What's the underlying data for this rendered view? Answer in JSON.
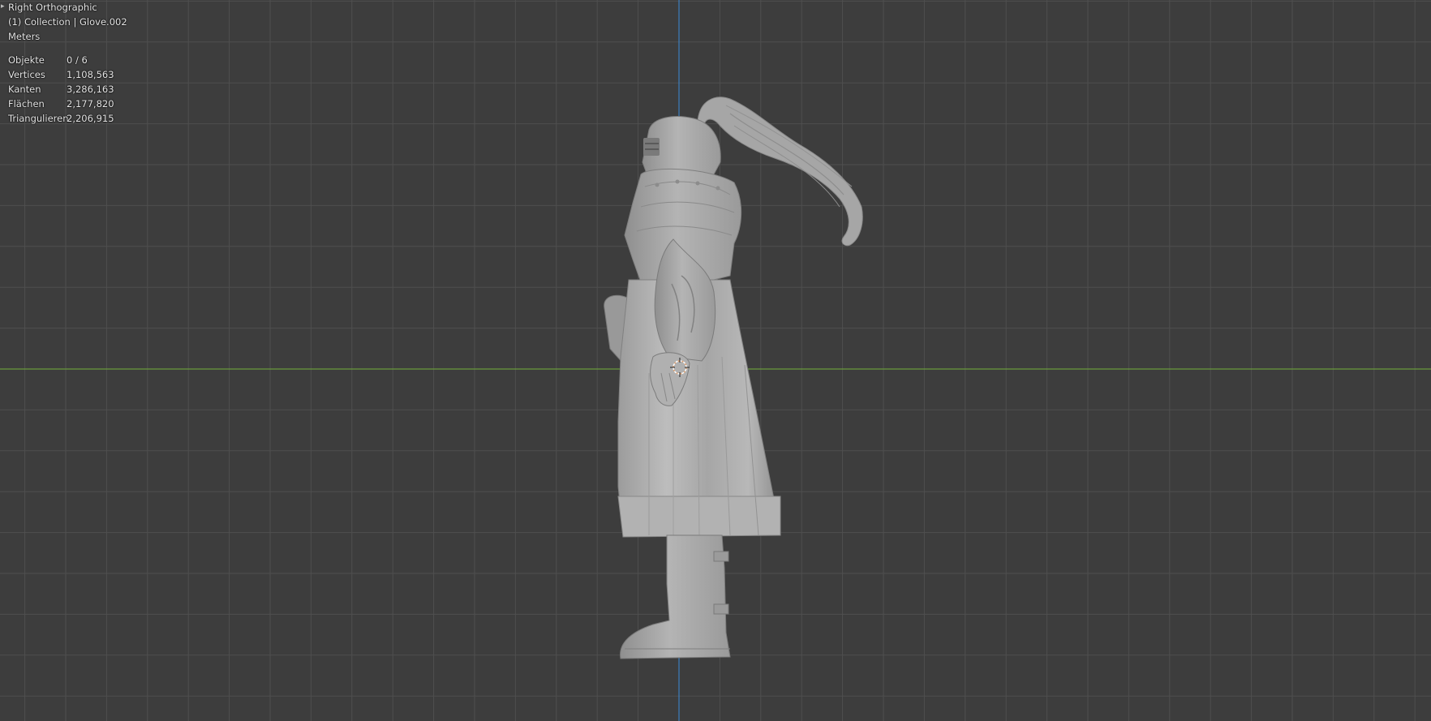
{
  "viewport": {
    "view_name": "Right Orthographic",
    "collection_info": "(1) Collection | Glove.002",
    "units": "Meters",
    "stats": [
      {
        "label": "Objekte",
        "value": "0 / 6"
      },
      {
        "label": "Vertices",
        "value": "1,108,563"
      },
      {
        "label": "Kanten",
        "value": "3,286,163"
      },
      {
        "label": "Flächen",
        "value": "2,177,820"
      },
      {
        "label": "Triangulieren",
        "value": "2,206,915"
      }
    ],
    "colors": {
      "background": "#3d3d3d",
      "grid_line": "#4f4f4f",
      "axis_y": "#3d7fbf",
      "axis_x": "#6a9a3c",
      "model": "#a9a9a9",
      "origin_cursor": "#e0a070"
    },
    "expand_icon": "chevron-right-icon"
  }
}
